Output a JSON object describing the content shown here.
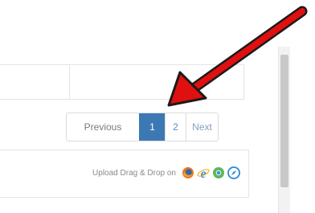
{
  "pagination": {
    "previous_label": "Previous",
    "pages": [
      "1",
      "2"
    ],
    "current_page": "1",
    "next_label": "Next"
  },
  "upload": {
    "label": "Upload Drag & Drop on",
    "browser_icons": [
      "firefox-icon",
      "internet-explorer-icon",
      "chrome-icon",
      "safari-icon"
    ]
  },
  "colors": {
    "active_page": "#3c79b4",
    "link": "#5d8bbf",
    "annotation_arrow": "#e01010"
  }
}
